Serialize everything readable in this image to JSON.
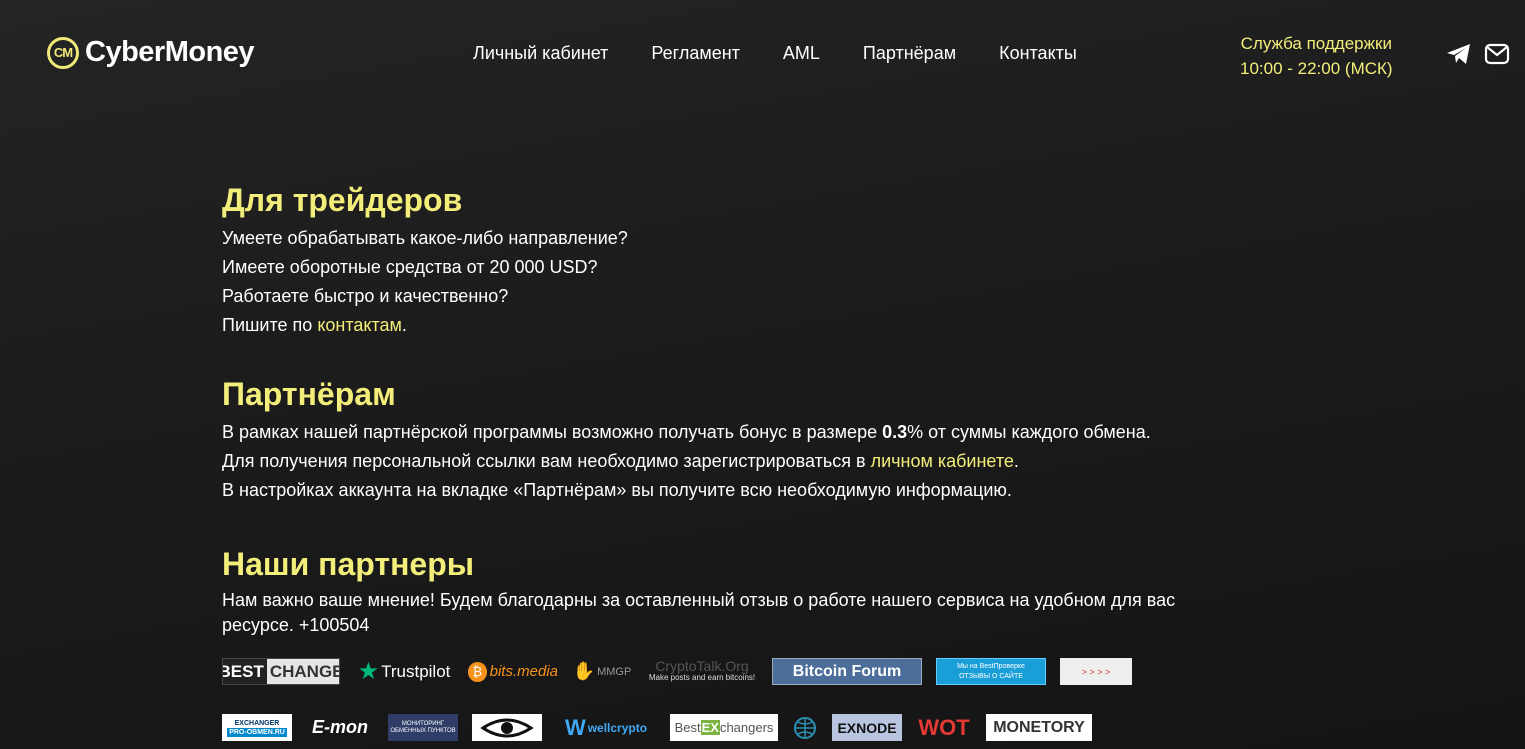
{
  "header": {
    "logo_text": "CyberMoney",
    "logo_mark": "CM",
    "nav": [
      "Личный кабинет",
      "Регламент",
      "AML",
      "Партнёрам",
      "Контакты"
    ],
    "support_title": "Служба поддержки",
    "support_hours": "10:00 - 22:00 (МСК)",
    "social_icons": [
      "telegram-icon",
      "mail-icon"
    ]
  },
  "traders": {
    "title": "Для трейдеров",
    "line1": "Умеете обрабатывать какое-либо направление?",
    "line2": "Имеете оборотные средства от 20 000 USD?",
    "line3": "Работаете быстро и качественно?",
    "line4_pre": "Пишите по ",
    "line4_link": "контактам",
    "line4_post": "."
  },
  "partners": {
    "title": "Партнёрам",
    "line1_pre": "В рамках нашей партнёрской программы возможно получать бонус в размере ",
    "line1_bold": "0.3",
    "line1_post": "% от суммы каждого обмена.",
    "line2_pre": "Для получения персональной ссылки вам необходимо зарегистрироваться в ",
    "line2_link": "личном кабинете",
    "line2_post": ".",
    "line3": "В настройках аккаунта на вкладке «Партнёрам» вы получите всю необходимую информацию."
  },
  "our_partners": {
    "title": "Наши партнеры",
    "text": "Нам важно ваше мнение! Будем благодарны за оставленный отзыв о работе нашего сервиса на удобном для вас ресурсе. +100504"
  },
  "badges_row1": [
    {
      "best": "BEST",
      "change": "CHANGE"
    },
    {
      "label": "Trustpilot"
    },
    {
      "label": "bits.media"
    },
    {
      "label": "MMGP"
    },
    {
      "label": "CryptoTalk.Org",
      "sub": "Make posts and earn bitcoins!"
    },
    {
      "label": "Bitcoin Forum"
    },
    {
      "label": "Мы на BestПроверке",
      "sub": "ОТЗЫВЫ О САЙТЕ"
    },
    {
      "label": "> > > >"
    }
  ],
  "badges_row2": [
    {
      "label": "EXCHANGER",
      "sub": "PRO-OBMEN.RU"
    },
    {
      "label": "E-mon"
    },
    {
      "label": "МОНИТОРИНГ ОБМЕННЫХ ПУНКТОВ"
    },
    {
      "label": "eye"
    },
    {
      "label": "wellcrypto"
    },
    {
      "pre": "Best",
      "ex": "EX",
      "post": "changers"
    },
    {
      "label": "globe"
    },
    {
      "label": "EXNODE"
    },
    {
      "label": "WOT"
    },
    {
      "label": "MONETORY"
    }
  ],
  "colors": {
    "accent": "#f3ed7a",
    "background": "#1e1e1e"
  }
}
